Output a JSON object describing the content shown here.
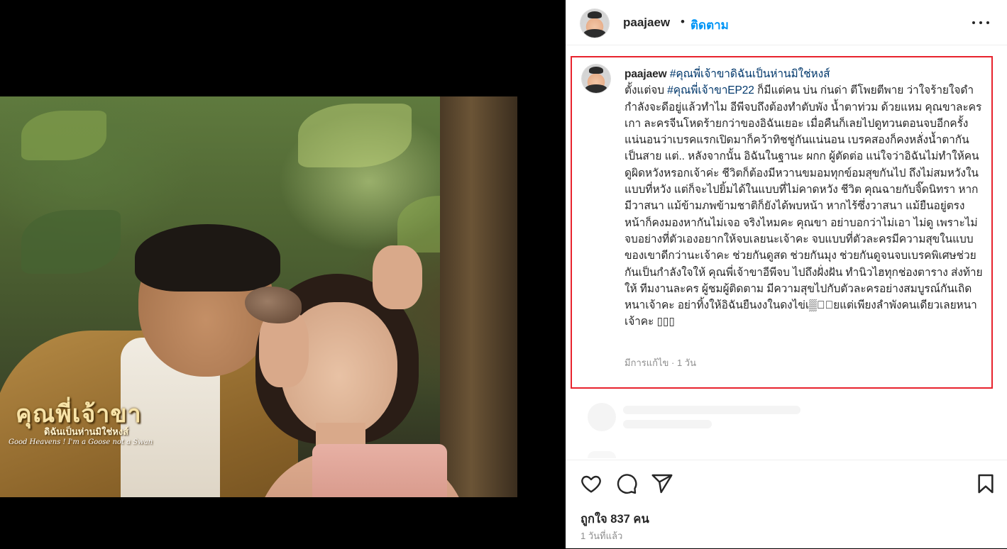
{
  "post": {
    "logo": {
      "title": "คุณพี่เจ้าขา",
      "subtitle": "ดิฉันเป็นห่านมิใช่หงส์",
      "english": "Good Heavens ! I'm a Goose not a Swan"
    }
  },
  "header": {
    "username": "paajaew",
    "separator": "•",
    "follow_label": "ติดตาม",
    "more_icon": "more-horizontal-icon"
  },
  "caption": {
    "username": "paajaew",
    "hashtag_1": "#คุณพี่เจ้าขาดิฉันเป็นห่านมิใช่หงส์",
    "text_1": "ตั้งแต่จบ",
    "hashtag_2": "#คุณพี่เจ้าขาEP22",
    "text_2": "ก็มีแต่คน บ่น ก่นด่า ตีโพยตีพาย ว่าใจร้ายใจดำ กำลังจะดีอยู่แล้วทำไม อีพีจบถึงต้องทำตับพัง น้ำตาท่วม ด้วยแหม คุณขาละครเกา ละครจีนโหดร้ายกว่าของอิฉันเยอะ เมื่อคืนก็เลยไปดูทวนตอนจบอีกครั้ง แน่นอนว่าเบรคแรกเปิดมาก็คว้าทิชชู่กันแน่นอน เบรคสองก็คงหลั่งน้ำตากันเป็นสาย แต่.. หลังจากนั้น อิฉันในฐานะ ผกก ผู้ตัดต่อ แน่ใจว่าอิฉันไม่ทำให้คนดูผิดหวังหรอกเจ้าค่ะ ชีวิตก็ต้องมีหวานขมอมทุกข์อมสุขกันไป ถึงไม่สมหวังในแบบที่หวัง แต่ก็จะไปยิ้มได้ในแบบที่ไม่คาดหวัง ชีวิต คุณฉายกับจิ๊ดนิทรา หากมีวาสนา แม้ข้ามภพข้ามชาติก็ยังได้พบหน้า หากไร้ซึ่งวาสนา แม้ยืนอยู่ตรงหน้าก็คงมองหากันไม่เจอ จริงไหมคะ คุณขา อย่าบอกว่าไม่เอา ไม่ดู เพราะไม่จบอย่างที่ตัวเองอยากให้จบเลยนะเจ้าคะ จบแบบที่ตัวละครมีความสุขในแบบของเขาดีกว่านะเจ้าคะ ช่วยกันดูสด ช่วยกันมุง ช่วยกันดูจนจบเบรคพิเศษช่วยกันเป็นกำลังใจให้ คุณพี่เจ้าขาอีพีจบ ไปถึงฝั่งฝัน ทำนิวไฮทุกช่องตาราง ส่งท้ายให้ ทีมงานละคร ผู้ชมผู้ติดตาม มีความสุขไปกับตัวละครอย่างสมบูรณ์กันเถิดหนาเจ้าคะ อย่าทิ้งให้อิฉันยืนงงในดงไข่เ▒ี้ยแต่เพียงลำพังคนเดียวเลยหนาเจ้าคะ ▯▯▯",
    "meta": "มีการแก้ไข · 1 วัน"
  },
  "actions": {
    "like_icon": "heart-icon",
    "comment_icon": "comment-icon",
    "share_icon": "send-icon",
    "save_icon": "bookmark-icon",
    "likes": "ถูกใจ 837 คน",
    "time_ago": "1 วันที่แล้ว"
  },
  "colors": {
    "follow": "#0095f6",
    "hashtag": "#00376b",
    "highlight_border": "#e8232d",
    "muted": "#8e8e8e"
  }
}
